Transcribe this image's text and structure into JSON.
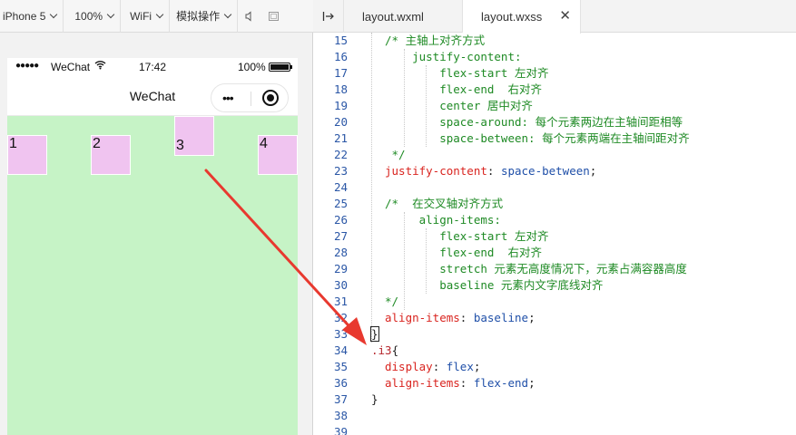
{
  "simulator": {
    "toolbar": {
      "device": "iPhone 5",
      "zoom": "100%",
      "network": "WiFi",
      "operation": "模拟操作",
      "icons": [
        "speaker-icon",
        "window-icon"
      ]
    },
    "status_bar": {
      "signal": "●●●●●",
      "carrier": "WeChat",
      "time": "17:42",
      "battery_text": "100%",
      "battery_level": 1.0
    },
    "nav": {
      "title": "WeChat",
      "capsule_more": "•••"
    },
    "boxes": [
      "1",
      "2",
      "3",
      "4"
    ],
    "colors": {
      "container_bg": "#c6f3c6",
      "box_bg": "#f0c4f0",
      "annotation_arrow": "#e8392f"
    }
  },
  "editor": {
    "toggle_icon": "sidebar-toggle-icon",
    "tabs": [
      {
        "label": "layout.wxml",
        "active": false
      },
      {
        "label": "layout.wxss",
        "active": true,
        "close": "✕"
      }
    ],
    "lines": [
      {
        "n": "15",
        "parts": [
          [
            "c-com",
            "/* 主轴上对齐方式"
          ]
        ]
      },
      {
        "n": "16",
        "parts": [
          [
            "c-com",
            "    justify-content:"
          ]
        ]
      },
      {
        "n": "17",
        "parts": [
          [
            "c-com",
            "        flex-start 左对齐"
          ]
        ]
      },
      {
        "n": "18",
        "parts": [
          [
            "c-com",
            "        flex-end  右对齐"
          ]
        ]
      },
      {
        "n": "19",
        "parts": [
          [
            "c-com",
            "        center 居中对齐"
          ]
        ]
      },
      {
        "n": "20",
        "parts": [
          [
            "c-com",
            "        space-around: 每个元素两边在主轴间距相等"
          ]
        ]
      },
      {
        "n": "21",
        "parts": [
          [
            "c-com",
            "        space-between: 每个元素两端在主轴间距对齐"
          ]
        ]
      },
      {
        "n": "22",
        "parts": [
          [
            "c-com",
            " */"
          ]
        ]
      },
      {
        "n": "23",
        "parts": [
          [
            "c-prop",
            "justify-content"
          ],
          [
            "c-punc",
            ": "
          ],
          [
            "c-val",
            "space-between"
          ],
          [
            "c-punc",
            ";"
          ]
        ]
      },
      {
        "n": "24",
        "parts": []
      },
      {
        "n": "25",
        "parts": [
          [
            "c-com",
            "/*  在交叉轴对齐方式"
          ]
        ]
      },
      {
        "n": "26",
        "parts": [
          [
            "c-com",
            "     align-items:"
          ]
        ]
      },
      {
        "n": "27",
        "parts": [
          [
            "c-com",
            "        flex-start 左对齐"
          ]
        ]
      },
      {
        "n": "28",
        "parts": [
          [
            "c-com",
            "        flex-end  右对齐"
          ]
        ]
      },
      {
        "n": "29",
        "parts": [
          [
            "c-com",
            "        stretch 元素无高度情况下，元素占满容器高度"
          ]
        ]
      },
      {
        "n": "30",
        "parts": [
          [
            "c-com",
            "        baseline 元素内文字底线对齐"
          ]
        ]
      },
      {
        "n": "31",
        "parts": [
          [
            "c-com",
            "*/"
          ]
        ]
      },
      {
        "n": "32",
        "parts": [
          [
            "c-prop",
            "align-items"
          ],
          [
            "c-punc",
            ": "
          ],
          [
            "c-val",
            "baseline"
          ],
          [
            "c-punc",
            ";"
          ]
        ]
      },
      {
        "n": "33",
        "parts": [
          [
            "c-punc cursor-box",
            "}"
          ]
        ],
        "indent": -1
      },
      {
        "n": "34",
        "parts": [
          [
            "c-sel",
            ".i3"
          ],
          [
            "c-punc",
            "{"
          ]
        ],
        "indent": -1
      },
      {
        "n": "35",
        "parts": [
          [
            "c-prop",
            "display"
          ],
          [
            "c-punc",
            ": "
          ],
          [
            "c-val",
            "flex"
          ],
          [
            "c-punc",
            ";"
          ]
        ]
      },
      {
        "n": "36",
        "parts": [
          [
            "c-prop",
            "align-items"
          ],
          [
            "c-punc",
            ": "
          ],
          [
            "c-val",
            "flex-end"
          ],
          [
            "c-punc",
            ";"
          ]
        ]
      },
      {
        "n": "37",
        "parts": [
          [
            "c-punc",
            "}"
          ]
        ],
        "indent": -1
      },
      {
        "n": "38",
        "parts": []
      },
      {
        "n": "39",
        "parts": []
      }
    ]
  }
}
